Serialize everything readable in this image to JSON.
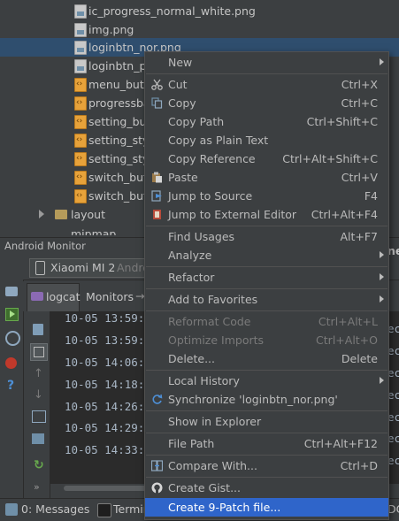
{
  "tree": {
    "files": [
      {
        "name": "ic_progress_normal_white.png",
        "kind": "img"
      },
      {
        "name": "img.png",
        "kind": "img"
      },
      {
        "name": "loginbtn_nor.png",
        "kind": "img"
      },
      {
        "name": "loginbtn_pr",
        "kind": "img"
      },
      {
        "name": "menu_butto",
        "kind": "xml"
      },
      {
        "name": "progressba",
        "kind": "xml"
      },
      {
        "name": "setting_but",
        "kind": "xml"
      },
      {
        "name": "setting_styl",
        "kind": "xml"
      },
      {
        "name": "setting_styl",
        "kind": "xml"
      },
      {
        "name": "switch_butt",
        "kind": "xml"
      },
      {
        "name": "switch_butt",
        "kind": "xml"
      }
    ],
    "folder_label": "layout",
    "partial_folder_label": "mipmap"
  },
  "monitor": {
    "title": "Android Monitor",
    "device": "Xiaomi MI 2",
    "device_suffix": "Andro",
    "tabs": {
      "logcat": "logcat",
      "monitors": "Monitors"
    },
    "log_times": [
      "10-05 13:59:",
      "10-05 13:59:",
      "10-05 14:06:",
      "10-05 14:18:",
      "10-05 14:26:",
      "10-05 14:29:",
      "10-05 14:33:"
    ],
    "log_tail": "ec"
  },
  "status": {
    "messages": "0: Messages",
    "terminal": "Termin"
  },
  "menu": {
    "items": [
      {
        "label": "New",
        "shortcut": "",
        "submenu": true,
        "icon": ""
      },
      {
        "label": "Cut",
        "shortcut": "Ctrl+X",
        "icon": "scissors"
      },
      {
        "label": "Copy",
        "shortcut": "Ctrl+C",
        "icon": "copy"
      },
      {
        "label": "Copy Path",
        "shortcut": "Ctrl+Shift+C",
        "icon": ""
      },
      {
        "label": "Copy as Plain Text",
        "shortcut": "",
        "icon": ""
      },
      {
        "label": "Copy Reference",
        "shortcut": "Ctrl+Alt+Shift+C",
        "icon": ""
      },
      {
        "label": "Paste",
        "shortcut": "Ctrl+V",
        "icon": "paste"
      },
      {
        "label": "Jump to Source",
        "shortcut": "F4",
        "icon": "jump"
      },
      {
        "label": "Jump to External Editor",
        "shortcut": "Ctrl+Alt+F4",
        "icon": "external"
      },
      {
        "label": "Find Usages",
        "shortcut": "Alt+F7",
        "icon": ""
      },
      {
        "label": "Analyze",
        "shortcut": "",
        "submenu": true,
        "icon": ""
      },
      {
        "label": "Refactor",
        "shortcut": "",
        "submenu": true,
        "icon": ""
      },
      {
        "label": "Add to Favorites",
        "shortcut": "",
        "submenu": true,
        "icon": ""
      },
      {
        "label": "Reformat Code",
        "shortcut": "Ctrl+Alt+L",
        "disabled": true,
        "icon": ""
      },
      {
        "label": "Optimize Imports",
        "shortcut": "Ctrl+Alt+O",
        "disabled": true,
        "icon": ""
      },
      {
        "label": "Delete...",
        "shortcut": "Delete",
        "icon": ""
      },
      {
        "label": "Local History",
        "shortcut": "",
        "submenu": true,
        "icon": ""
      },
      {
        "label": "Synchronize 'loginbtn_nor.png'",
        "shortcut": "",
        "icon": "sync"
      },
      {
        "label": "Show in Explorer",
        "shortcut": "",
        "icon": ""
      },
      {
        "label": "File Path",
        "shortcut": "Ctrl+Alt+F12",
        "icon": ""
      },
      {
        "label": "Compare With...",
        "shortcut": "Ctrl+D",
        "icon": "compare"
      },
      {
        "label": "Create Gist...",
        "shortcut": "",
        "icon": "github"
      },
      {
        "label": "Create 9-Patch file...",
        "shortcut": "",
        "highlighted": true,
        "icon": ""
      }
    ],
    "right_edge_fragments": [
      "ne",
      "DC"
    ]
  },
  "colors": {
    "menu_highlight": "#2f65ca",
    "selection": "#2f4e6e",
    "background": "#3c3f41"
  }
}
